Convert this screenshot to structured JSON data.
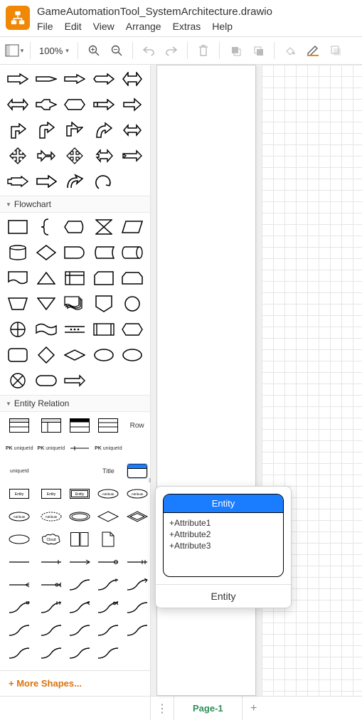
{
  "header": {
    "title": "GameAutomationTool_SystemArchitecture.drawio",
    "menu": {
      "file": "File",
      "edit": "Edit",
      "view": "View",
      "arrange": "Arrange",
      "extras": "Extras",
      "help": "Help"
    }
  },
  "toolbar": {
    "zoom": "100%"
  },
  "sidebar": {
    "sections": {
      "flowchart": "Flowchart",
      "entity": "Entity Relation"
    },
    "er_labels": {
      "row": "Row",
      "title": "Title",
      "pk": "PK",
      "entity": "Entity",
      "attribute": "Attribute",
      "cloud": "Cloud"
    },
    "more": "More Shapes..."
  },
  "preview": {
    "title": "Entity",
    "attrs": [
      "+Attribute1",
      "+Attribute2",
      "+Attribute3"
    ],
    "caption": "Entity"
  },
  "footer": {
    "page": "Page-1"
  }
}
